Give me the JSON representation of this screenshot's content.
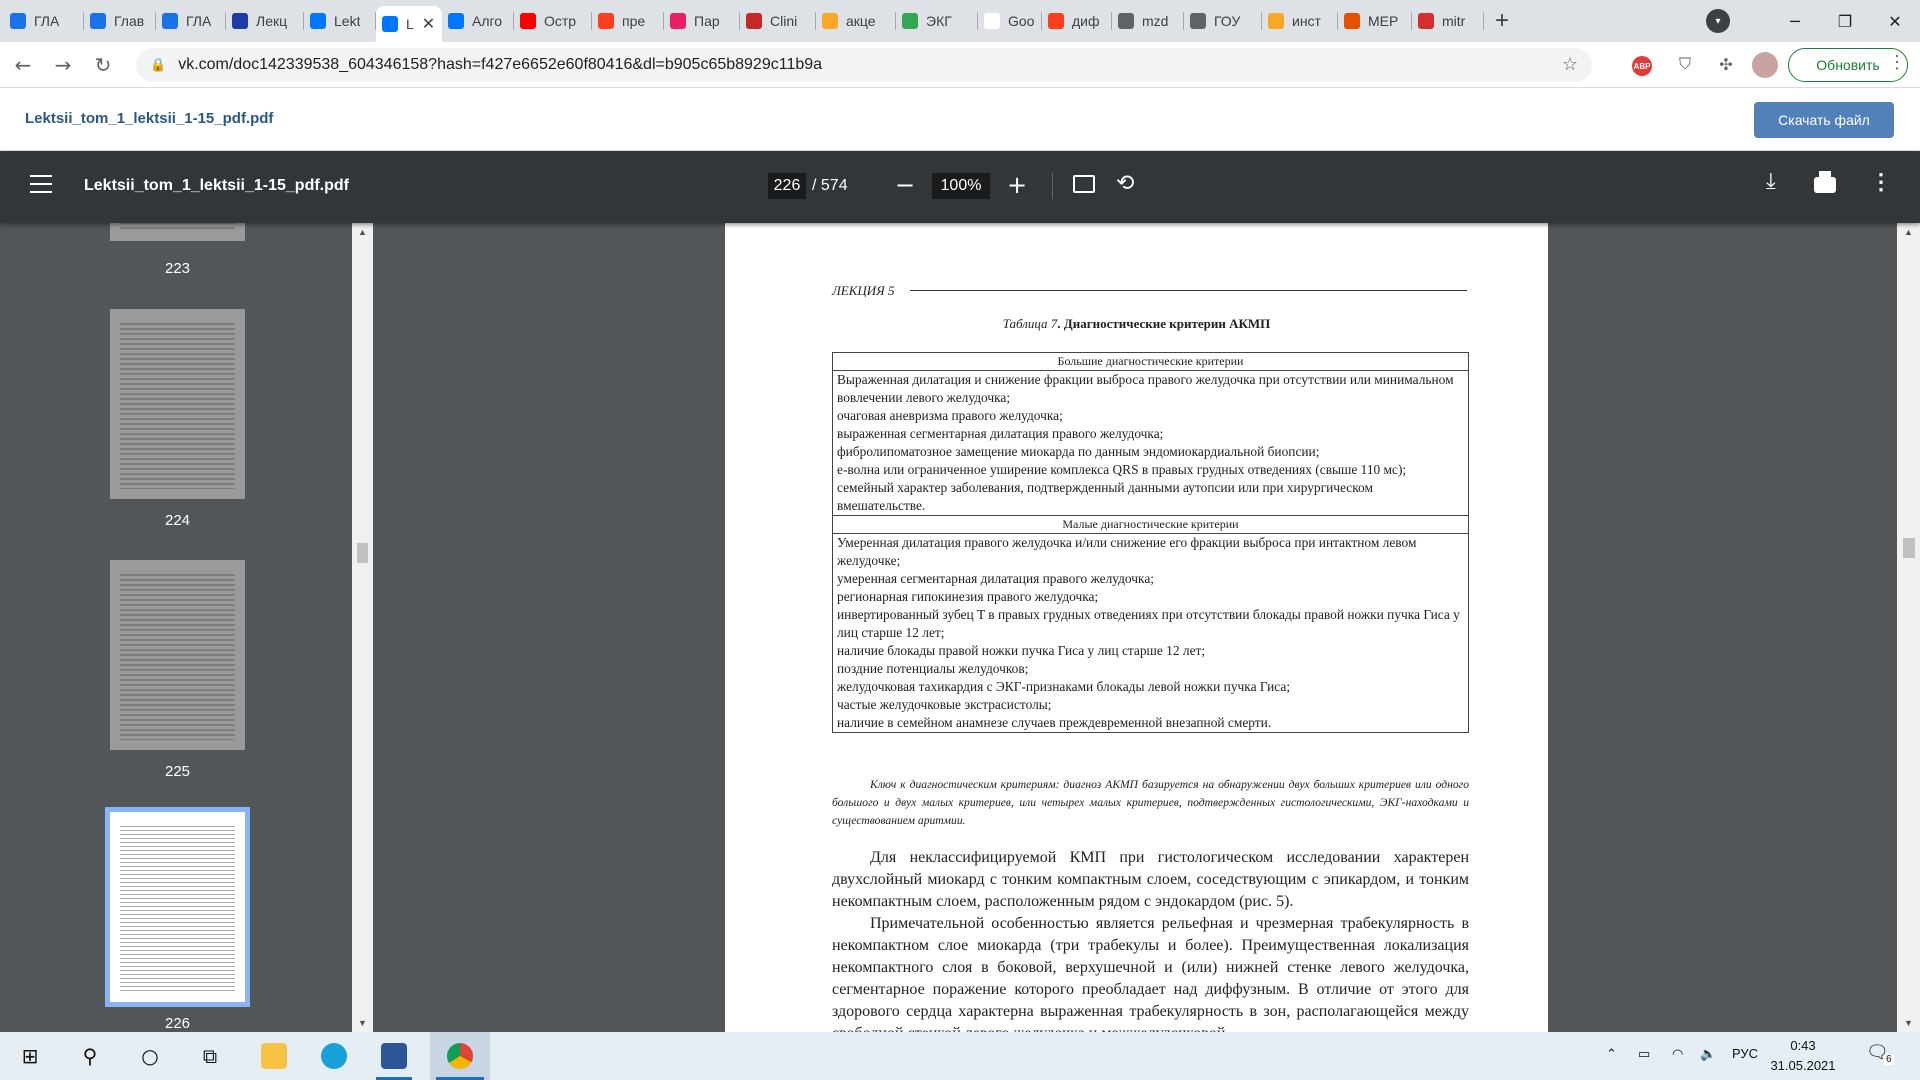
{
  "browser": {
    "tabs": [
      {
        "label": "ГЛА",
        "color": "#1a73e8"
      },
      {
        "label": "Глав",
        "color": "#1a73e8"
      },
      {
        "label": "ГЛА",
        "color": "#1a73e8"
      },
      {
        "label": "Лекц",
        "color": "#1d3ca6"
      },
      {
        "label": "Lekt",
        "color": "#0077ff"
      },
      {
        "label": "L",
        "color": "#0077ff",
        "active": true
      },
      {
        "label": "Алго",
        "color": "#0077ff"
      },
      {
        "label": "Остр",
        "color": "#ff0000"
      },
      {
        "label": "пре",
        "color": "#fc3f1d"
      },
      {
        "label": "Пар",
        "color": "#e91e63"
      },
      {
        "label": "Clini",
        "color": "#c62828"
      },
      {
        "label": "акце",
        "color": "#f9a825"
      },
      {
        "label": "ЭКГ",
        "color": "#34a853"
      },
      {
        "label": "Goo",
        "color": "#ffffff"
      },
      {
        "label": "диф",
        "color": "#fc3f1d"
      },
      {
        "label": "mzd",
        "color": "#5f6368"
      },
      {
        "label": "ГОУ",
        "color": "#5f6368"
      },
      {
        "label": "инст",
        "color": "#f9a825"
      },
      {
        "label": "МЕР",
        "color": "#e65100"
      },
      {
        "label": "mitr",
        "color": "#d32f2f"
      }
    ],
    "url": "vk.com/doc142339538_604346158?hash=f427e6652e60f80416&dl=b905c65b8929c11b9a",
    "update_label": "Обновить",
    "abp_label": "ABP"
  },
  "vk": {
    "doc_name": "Lektsii_tom_1_lektsii_1-15_pdf.pdf",
    "download_label": "Скачать файл"
  },
  "pdf": {
    "title": "Lektsii_tom_1_lektsii_1-15_pdf.pdf",
    "current_page": "226",
    "total_pages": "/ 574",
    "zoom": "100%",
    "thumbnails": [
      "223",
      "224",
      "225",
      "226"
    ]
  },
  "document": {
    "lecture_header": "ЛЕКЦИЯ 5",
    "table_caption_italic": "Таблица 7",
    "table_caption_bold": ". Диагностические критерии АКМП",
    "major_header": "Большие диагностические критерии",
    "major_items": [
      "Выраженная дилатация и снижение фракции выброса правого желудочка при отсутствии или минимальном вовлечении левого желудочка;",
      "очаговая аневризма правого желудочка;",
      "выраженная сегментарная дилатация правого желудочка;",
      "фибролипоматозное замещение миокарда по данным эндомиокардиальной биопсии;",
      "e-волна или ограниченное уширение комплекса QRS в правых грудных отведениях (свыше 110 мс);",
      "семейный характер заболевания, подтвержденный данными аутопсии или при хирургическом вмешательстве."
    ],
    "minor_header": "Малые диагностические критерии",
    "minor_items": [
      "Умеренная дилатация правого желудочка и/или снижение его фракции выброса при интактном левом желудочке;",
      "умеренная сегментарная дилатация правого желудочка;",
      "регионарная гипокинезия правого желудочка;",
      "инвертированный зубец T в правых грудных отведениях при отсутствии блокады правой ножки пучка Гиса у лиц старше 12 лет;",
      "наличие блокады правой ножки пучка Гиса у лиц старше 12 лет;",
      "поздние потенциалы желудочков;",
      "желудочковая тахикардия с ЭКГ-признаками блокады левой ножки пучка Гиса;",
      "частые желудочковые экстрасистолы;",
      "наличие в семейном анамнезе случаев преждевременной внезапной смерти."
    ],
    "key_note": "Ключ к диагностическим критериям: диагноз АКМП базируется на обнаружении двух больших критериев или одного большого и двух малых критериев, или четырех малых критериев, подтвержденных гистологическими, ЭКГ-находками и существованием аритмии.",
    "paragraph_1": "Для неклассифицируемой КМП при гистологическом исследовании характерен двухслойный миокард с тонким компактным слоем, соседствующим с эпикардом, и тонким некомпактным слоем, расположенным рядом с эндокардом (рис. 5).",
    "paragraph_2": "Примечательной особенностью является рельефная и чрезмерная трабекулярность в некомпактном слое миокарда (три трабекулы и более). Преимущественная локализация некомпактного слоя в боковой, верхушечной и (или) нижней стенке левого желудочка, сегментарное поражение которого преобладает над диффузным. В отличие от этого для здорового сердца характерна выраженная трабекулярность в зон, располагающейся между свободной стенкой левого желудочка и межжелудочковой"
  },
  "taskbar": {
    "language": "РУС",
    "time": "0:43",
    "date": "31.05.2021",
    "notifications": "6"
  }
}
